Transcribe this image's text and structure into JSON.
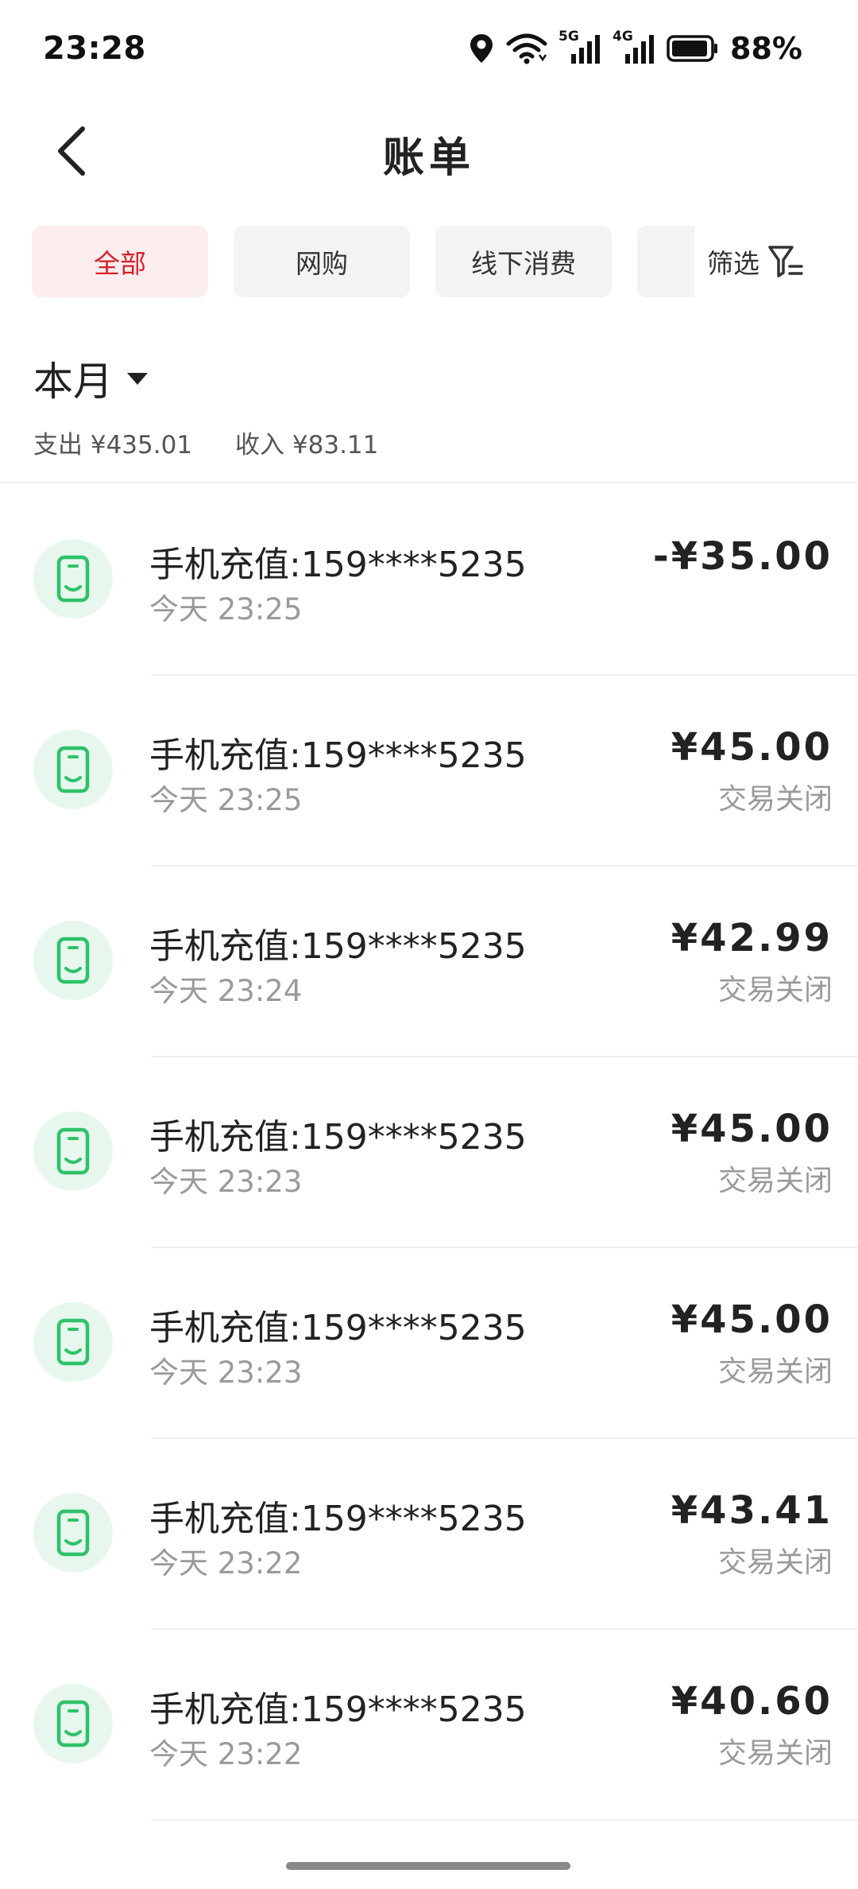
{
  "status_bar": {
    "time": "23:28",
    "battery_percent": "88%",
    "net_5g": "5G",
    "net_4g": "4G",
    "icons": [
      "location-icon",
      "wifi-icon",
      "signal-5g-icon",
      "signal-4g-icon",
      "battery-icon"
    ]
  },
  "header": {
    "title": "账单",
    "back_icon": "chevron-left-icon"
  },
  "tabs": [
    {
      "label": "全部",
      "active": true
    },
    {
      "label": "网购",
      "active": false
    },
    {
      "label": "线下消费",
      "active": false
    },
    {
      "label": "",
      "active": false
    }
  ],
  "filter": {
    "label": "筛选",
    "icon": "filter-icon"
  },
  "month": {
    "label": "本月",
    "expense": "支出 ¥435.01",
    "income": "收入 ¥83.11"
  },
  "colors": {
    "accent": "#d8202b",
    "active_tab_bg": "#fdeeee",
    "icon_green": "#2ec26a",
    "icon_bg": "#e7f7ed"
  },
  "transactions": [
    {
      "title": "手机充值:159****5235",
      "time": "今天 23:25",
      "amount": "-¥35.00",
      "status": ""
    },
    {
      "title": "手机充值:159****5235",
      "time": "今天 23:25",
      "amount": "¥45.00",
      "status": "交易关闭"
    },
    {
      "title": "手机充值:159****5235",
      "time": "今天 23:24",
      "amount": "¥42.99",
      "status": "交易关闭"
    },
    {
      "title": "手机充值:159****5235",
      "time": "今天 23:23",
      "amount": "¥45.00",
      "status": "交易关闭"
    },
    {
      "title": "手机充值:159****5235",
      "time": "今天 23:23",
      "amount": "¥45.00",
      "status": "交易关闭"
    },
    {
      "title": "手机充值:159****5235",
      "time": "今天 23:22",
      "amount": "¥43.41",
      "status": "交易关闭"
    },
    {
      "title": "手机充值:159****5235",
      "time": "今天 23:22",
      "amount": "¥40.60",
      "status": "交易关闭"
    }
  ]
}
